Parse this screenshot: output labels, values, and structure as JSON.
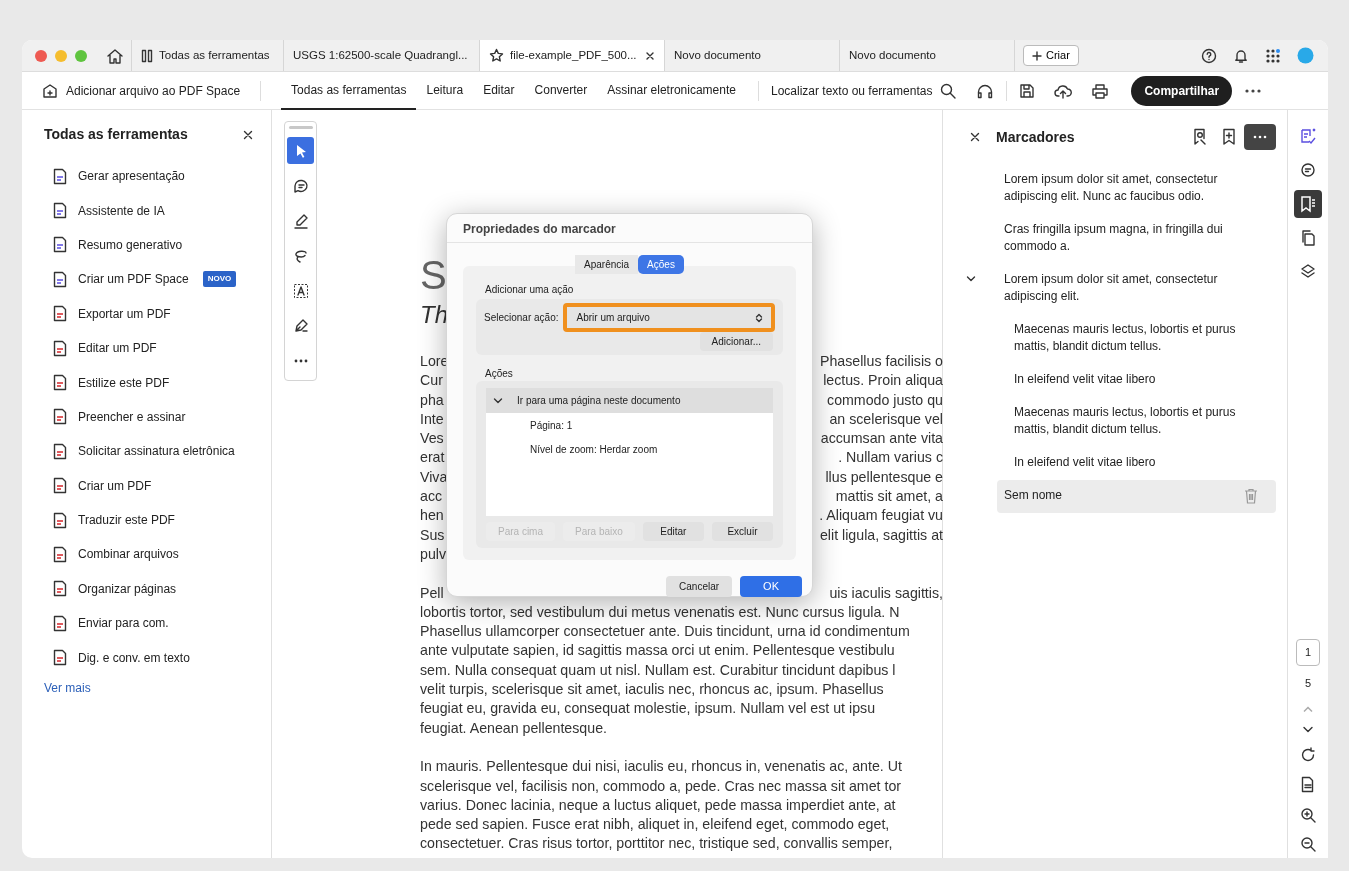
{
  "tabs": [
    {
      "label": "Todas as ferramentas",
      "kind": "tools",
      "selected": false
    },
    {
      "label": "USGS 1:62500-scale Quadrangl...",
      "kind": "document",
      "selected": false
    },
    {
      "label": "file-example_PDF_500...",
      "kind": "document",
      "selected": true
    },
    {
      "label": "Novo documento",
      "kind": "document",
      "selected": false
    },
    {
      "label": "Novo documento",
      "kind": "document",
      "selected": false
    }
  ],
  "new_tab_button": "Criar",
  "toolbar": {
    "add_to_space": "Adicionar arquivo ao PDF Space",
    "menu": [
      {
        "label": "Todas as ferramentas",
        "selected": true
      },
      {
        "label": "Leitura",
        "selected": false
      },
      {
        "label": "Editar",
        "selected": false
      },
      {
        "label": "Converter",
        "selected": false
      },
      {
        "label": "Assinar eletronicamente",
        "selected": false
      }
    ],
    "search_label": "Localizar texto ou ferramentas",
    "share": "Compartilhar"
  },
  "tools_panel": {
    "title": "Todas as ferramentas",
    "items": [
      {
        "label": "Gerar apresentação"
      },
      {
        "label": "Assistente de IA"
      },
      {
        "label": "Resumo generativo"
      },
      {
        "label": "Criar um PDF Space",
        "badge": "NOVO"
      },
      {
        "label": "Exportar um PDF"
      },
      {
        "label": "Editar um PDF"
      },
      {
        "label": "Estilize este PDF"
      },
      {
        "label": "Preencher e assinar"
      },
      {
        "label": "Solicitar assinatura eletrônica"
      },
      {
        "label": "Criar um PDF"
      },
      {
        "label": "Traduzir este PDF"
      },
      {
        "label": "Combinar arquivos"
      },
      {
        "label": "Organizar páginas"
      },
      {
        "label": "Enviar para com."
      },
      {
        "label": "Dig. e conv. em texto"
      }
    ],
    "more": "Ver mais"
  },
  "quick_tools": [
    {
      "kind": "select",
      "selected": true
    },
    {
      "kind": "comment",
      "selected": false
    },
    {
      "kind": "highlight",
      "selected": false
    },
    {
      "kind": "draw",
      "selected": false
    },
    {
      "kind": "text",
      "selected": false
    },
    {
      "kind": "sign",
      "selected": false
    },
    {
      "kind": "more",
      "selected": false
    }
  ],
  "document": {
    "heading": "S",
    "subheading": "Th",
    "paragraphs": [
      [
        {
          "left": "Lore",
          "right": "Phasellus facilisis o"
        },
        {
          "left": "Cur",
          "right": "lectus. Proin aliqua"
        },
        {
          "left": "pha",
          "right": "commodo justo qu"
        },
        {
          "left": "Inte",
          "right": "an scelerisque vel"
        },
        {
          "left": "Ves",
          "right": "accumsan ante vita"
        },
        {
          "left": "erat",
          "right": ". Nullam varius c"
        },
        {
          "left": "Viva",
          "right": "llus pellentesque e"
        },
        {
          "left": "acc",
          "right": "mattis sit amet, a"
        },
        {
          "left": "hen",
          "right": ". Aliquam feugiat vu"
        },
        {
          "left": "Sus",
          "right": "elit ligula, sagittis at"
        },
        {
          "left": "pulv"
        }
      ],
      [
        {
          "left": "Pell",
          "right": "uis iaculis sagittis,"
        },
        {
          "left": "lobortis tortor, sed vestibulum dui metus venenatis est. Nunc cursus ligula. N"
        },
        {
          "left": "Phasellus ullamcorper consectetuer ante. Duis tincidunt, urna id condimentum"
        },
        {
          "left": "ante vulputate sapien, id sagittis massa orci ut enim. Pellentesque vestibulu"
        },
        {
          "left": "sem. Nulla consequat quam ut nisl. Nullam est. Curabitur tincidunt dapibus l"
        },
        {
          "left": "velit turpis, scelerisque sit amet, iaculis nec, rhoncus ac, ipsum. Phasellus"
        },
        {
          "left": "feugiat eu, gravida eu, consequat molestie, ipsum. Nullam vel est ut ipsu"
        },
        {
          "left": "feugiat. Aenean pellentesque."
        }
      ],
      [
        {
          "left": "In mauris. Pellentesque dui nisi, iaculis eu, rhoncus in, venenatis ac, ante. Ut"
        },
        {
          "left": "scelerisque vel, facilisis non, commodo a, pede. Cras nec massa sit amet tor"
        },
        {
          "left": "varius. Donec lacinia, neque a luctus aliquet, pede massa imperdiet ante, at"
        },
        {
          "left": "pede sed sapien. Fusce erat nibh, aliquet in, eleifend eget, commodo eget,"
        },
        {
          "left": "consectetuer. Cras risus tortor, porttitor nec, tristique sed, convallis semper,"
        }
      ]
    ]
  },
  "dialog": {
    "title": "Propriedades do marcador",
    "tabs": [
      {
        "label": "Aparência",
        "selected": false
      },
      {
        "label": "Ações",
        "selected": true
      }
    ],
    "add_section": "Adicionar uma ação",
    "select_label": "Selecionar ação:",
    "select_value": "Abrir um arquivo",
    "highlighted": true,
    "add_button": "Adicionar...",
    "actions_label": "Ações",
    "actions": [
      {
        "label": "Ir para uma página neste documento",
        "expanded": true,
        "children": [
          {
            "label": "Página: 1"
          },
          {
            "label": "Nível de zoom: Herdar zoom"
          }
        ]
      }
    ],
    "buttons": [
      {
        "label": "Para cima",
        "disabled": true
      },
      {
        "label": "Para baixo",
        "disabled": true
      },
      {
        "label": "Editar",
        "disabled": false
      },
      {
        "label": "Excluir",
        "disabled": false
      }
    ],
    "cancel": "Cancelar",
    "ok": "OK"
  },
  "bookmarks": {
    "title": "Marcadores",
    "items": [
      {
        "label": "Lorem ipsum dolor sit amet, consectetur adipiscing elit. Nunc ac faucibus odio.",
        "selected": false
      },
      {
        "label": "Cras fringilla ipsum magna, in fringilla dui commodo a.",
        "selected": false
      },
      {
        "label": "Lorem ipsum dolor sit amet, consectetur adipiscing elit.",
        "selected": false,
        "expanded": true,
        "children": [
          {
            "label": "Maecenas mauris lectus, lobortis et purus mattis, blandit dictum tellus.",
            "selected": false
          },
          {
            "label": "In eleifend velit vitae libero",
            "selected": false
          },
          {
            "label": "Maecenas mauris lectus, lobortis et purus mattis, blandit dictum tellus.",
            "selected": false
          },
          {
            "label": "In eleifend velit vitae libero",
            "selected": false
          }
        ]
      },
      {
        "label": "Sem nome",
        "selected": true
      }
    ]
  },
  "rail": [
    {
      "kind": "ai",
      "selected": false
    },
    {
      "kind": "comment",
      "selected": false
    },
    {
      "kind": "bookmarks",
      "selected": true
    },
    {
      "kind": "pages",
      "selected": false
    },
    {
      "kind": "layers",
      "selected": false
    }
  ],
  "page_nav": {
    "current": "1",
    "total": "5"
  }
}
